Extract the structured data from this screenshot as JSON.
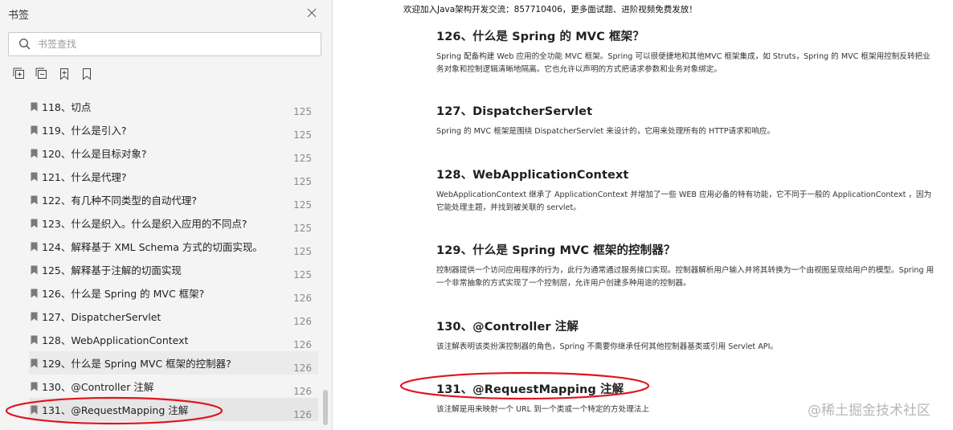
{
  "sidebar": {
    "title": "书签",
    "search_placeholder": "书签查找",
    "items": [
      {
        "label": "118、切点",
        "page": "125"
      },
      {
        "label": "119、什么是引入?",
        "page": "125"
      },
      {
        "label": "120、什么是目标对象?",
        "page": "125"
      },
      {
        "label": "121、什么是代理?",
        "page": "125"
      },
      {
        "label": "122、有几种不同类型的自动代理?",
        "page": "125"
      },
      {
        "label": "123、什么是织入。什么是织入应用的不同点?",
        "page": "125"
      },
      {
        "label": "124、解释基于 XML Schema 方式的切面实现。",
        "page": "125"
      },
      {
        "label": "125、解释基于注解的切面实现",
        "page": "125"
      },
      {
        "label": "126、什么是 Spring 的 MVC 框架?",
        "page": "126"
      },
      {
        "label": "127、DispatcherServlet",
        "page": "126"
      },
      {
        "label": "128、WebApplicationContext",
        "page": "126"
      },
      {
        "label": "129、什么是 Spring MVC 框架的控制器?",
        "page": "126"
      },
      {
        "label": "130、@Controller 注解",
        "page": "126"
      },
      {
        "label": "131、@RequestMapping 注解",
        "page": "126"
      }
    ],
    "cut_row_label": "..."
  },
  "doc": {
    "banner": "欢迎加入Java架构开发交流：857710406，更多面试题、进阶视频免费发放！",
    "sections": [
      {
        "title": "126、什么是 Spring 的 MVC 框架？",
        "body": "Spring 配备构建 Web 应用的全功能 MVC 框架。Spring 可以很便捷地和其他MVC 框架集成，如 Struts，Spring 的 MVC 框架用控制反转把业务对象和控制逻辑清晰地隔离。它也允许以声明的方式把请求参数和业务对象绑定。"
      },
      {
        "title": "127、DispatcherServlet",
        "body": "Spring 的 MVC 框架是围绕 DispatcherServlet 来设计的，它用来处理所有的 HTTP请求和响应。"
      },
      {
        "title": "128、WebApplicationContext",
        "body": "WebApplicationContext 继承了 ApplicationContext 并增加了一些 WEB 应用必备的特有功能，它不同于一般的 ApplicationContext ，因为它能处理主题，并找到被关联的 servlet。"
      },
      {
        "title": "129、什么是 Spring MVC 框架的控制器？",
        "body": "控制器提供一个访问应用程序的行为，此行为通常通过服务接口实现。控制器解析用户输入并将其转换为一个由视图呈现给用户的模型。Spring 用一个非常抽象的方式实现了一个控制层，允许用户创建多种用途的控制器。"
      },
      {
        "title": "130、@Controller 注解",
        "body": "该注解表明该类扮演控制器的角色，Spring 不需要你继承任何其他控制器基类或引用 Servlet API。"
      },
      {
        "title": "131、@RequestMapping 注解",
        "body": "该注解是用来映射一个 URL 到一个类或一个特定的方处理法上"
      }
    ],
    "watermark": "@稀土掘金技术社区"
  },
  "colors": {
    "sidebar_bg": "#f4f4f4",
    "selected_row": "#e6e6e6",
    "annotation_red": "#e0141e",
    "page_number": "#8a8a8a"
  }
}
